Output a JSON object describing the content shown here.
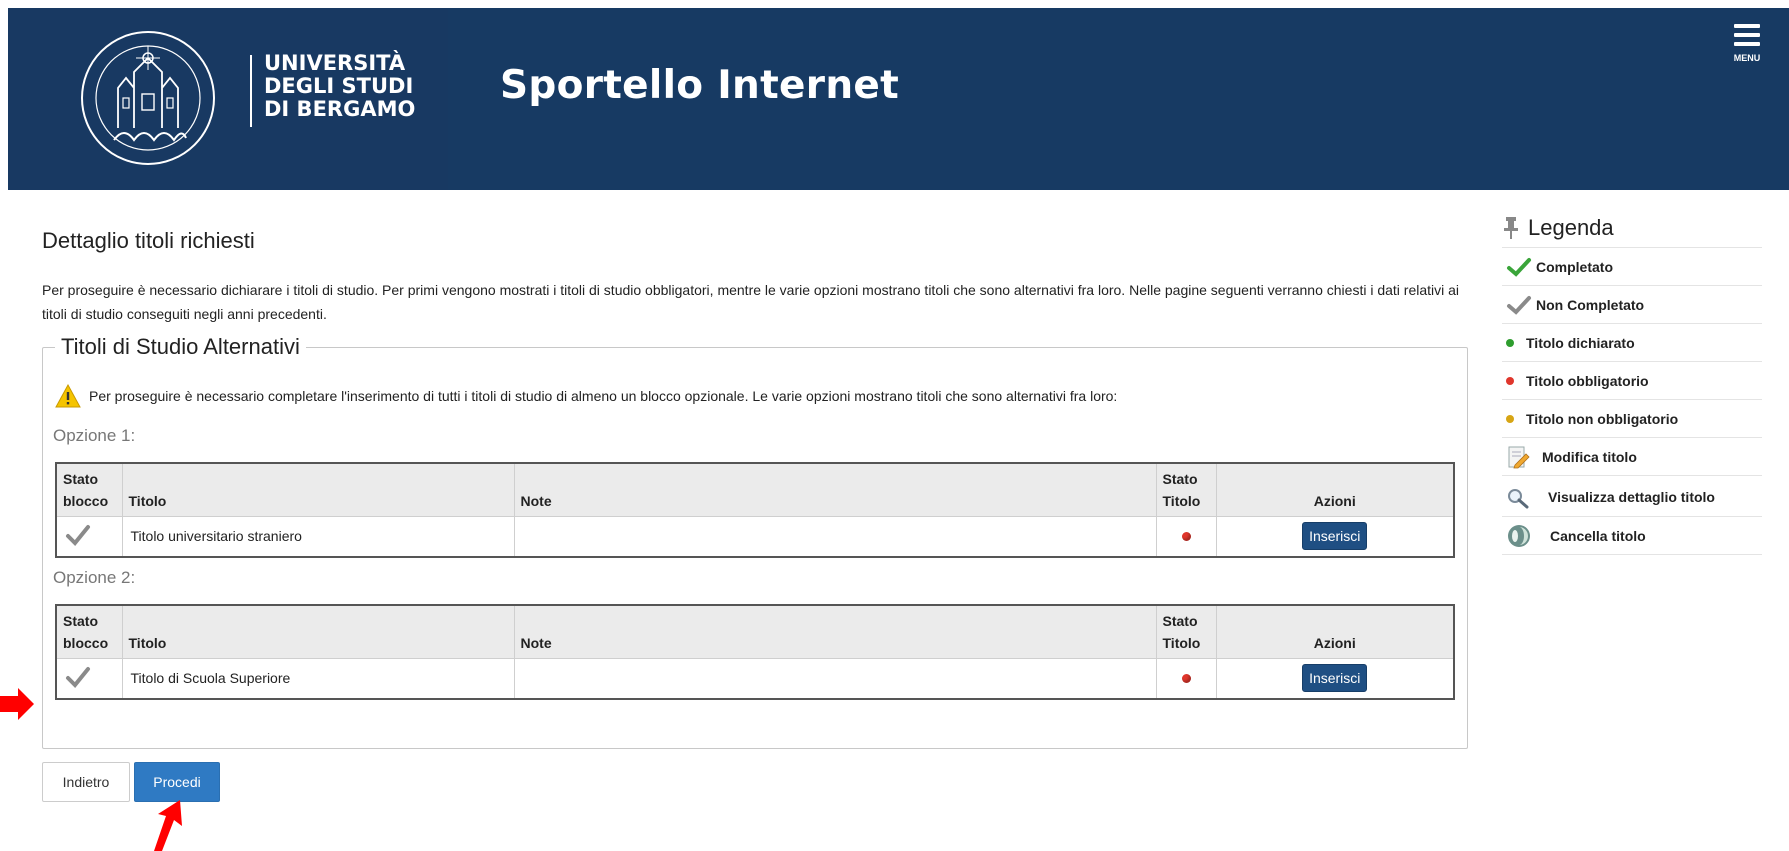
{
  "header": {
    "logo_lines": [
      "UNIVERSITÀ",
      "DEGLI STUDI",
      "DI BERGAMO"
    ],
    "logo_seal_text": "UNIVERSITAS STUDIORUM BERGOMENSIS",
    "site_title": "Sportello Internet",
    "menu_label": "MENU"
  },
  "page": {
    "title": "Dettaglio titoli richiesti",
    "intro": "Per proseguire è necessario dichiarare i titoli di studio. Per primi vengono mostrati i titoli di studio obbligatori, mentre le varie opzioni mostrano titoli che sono alternativi fra loro. Nelle pagine seguenti verranno chiesti i dati relativi ai titoli di studio conseguiti negli anni precedenti."
  },
  "section": {
    "legend": "Titoli di Studio Alternativi",
    "warning": "Per proseguire è necessario completare l'inserimento di tutti i titoli di studio di almeno un blocco opzionale. Le varie opzioni mostrano titoli che sono alternativi fra loro:",
    "columns": {
      "stato_blocco_1": "Stato",
      "stato_blocco_2": "blocco",
      "titolo": "Titolo",
      "note": "Note",
      "stato_titolo_1": "Stato",
      "stato_titolo_2": "Titolo",
      "azioni": "Azioni"
    },
    "options": [
      {
        "label": "Opzione 1:",
        "rows": [
          {
            "titolo": "Titolo universitario straniero",
            "note": "",
            "stato_titolo": "obbligatorio",
            "action": "Inserisci"
          }
        ]
      },
      {
        "label": "Opzione 2:",
        "rows": [
          {
            "titolo": "Titolo di Scuola Superiore",
            "note": "",
            "stato_titolo": "obbligatorio",
            "action": "Inserisci"
          }
        ]
      }
    ]
  },
  "buttons": {
    "back": "Indietro",
    "next": "Procedi"
  },
  "legend": {
    "title": "Legenda",
    "items": [
      {
        "icon": "check-green-icon",
        "label": "Completato"
      },
      {
        "icon": "check-gray-icon",
        "label": "Non Completato"
      },
      {
        "icon": "dot-green-icon",
        "label": "Titolo dichiarato"
      },
      {
        "icon": "dot-red-icon",
        "label": "Titolo obbligatorio"
      },
      {
        "icon": "dot-yellow-icon",
        "label": "Titolo non obbligatorio"
      },
      {
        "icon": "edit-icon",
        "label": "Modifica titolo"
      },
      {
        "icon": "magnifier-icon",
        "label": "Visualizza dettaglio titolo"
      },
      {
        "icon": "delete-icon",
        "label": "Cancella titolo"
      }
    ]
  },
  "colors": {
    "header_bg": "#173a63",
    "button_primary": "#2f7ac3",
    "button_insert": "#1f4f83",
    "status_red": "#e0362c",
    "status_green": "#2e9d2e",
    "status_yellow": "#d7a514",
    "annotation_arrow": "#ff0000"
  }
}
